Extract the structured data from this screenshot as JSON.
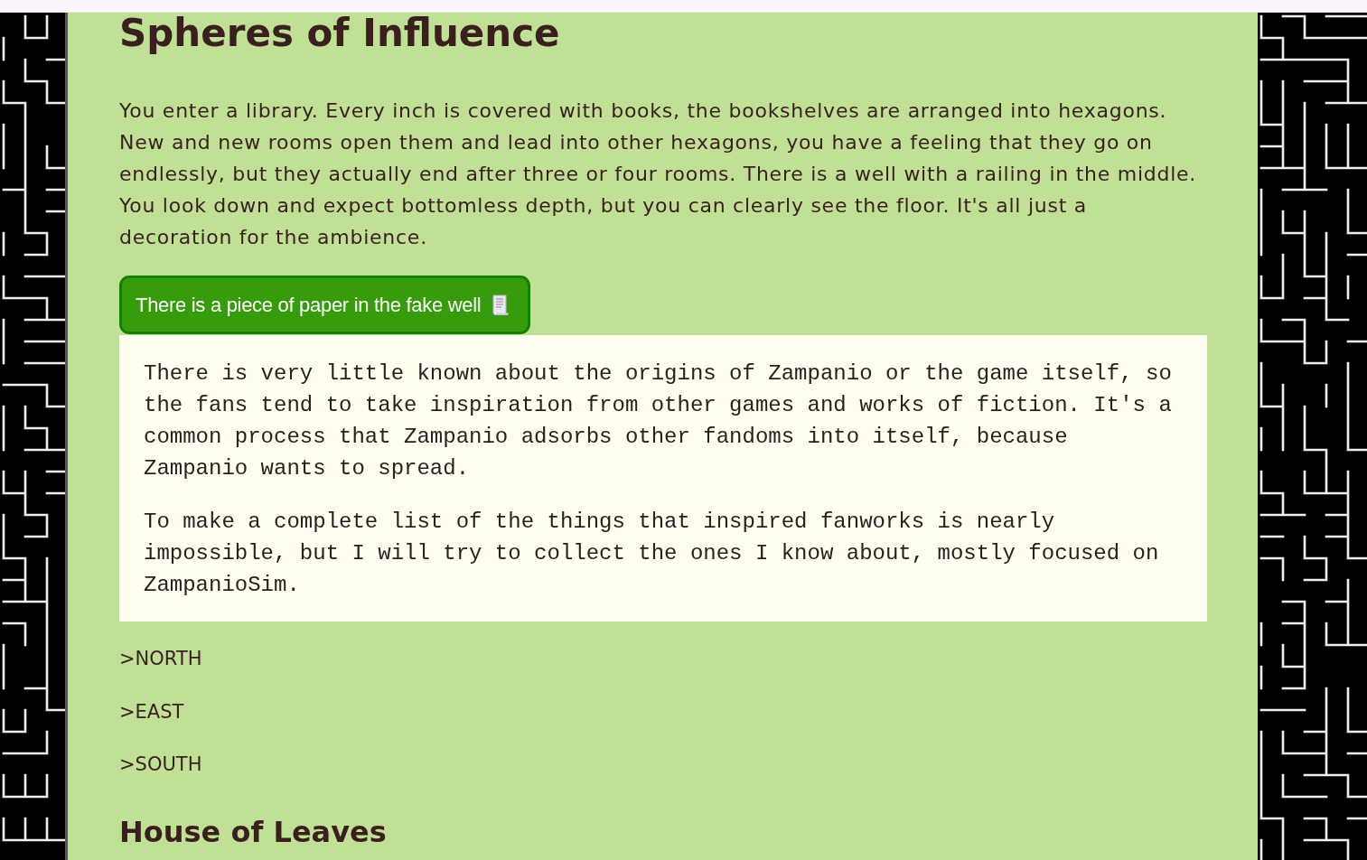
{
  "heading": "Spheres of Influence",
  "description": "You enter a library. Every inch is covered with books, the bookshelves are arranged into hexagons. New and new rooms open them and lead into other hexagons, you have a feeling that they go on endlessly, but they actually end after three or four rooms. There is a well with a railing in the middle. You look down and expect bottomless depth, but you can clearly see the floor. It's all just a decoration for the ambience.",
  "reveal_button": {
    "label": "There is a piece of paper in the fake well"
  },
  "paper_note": {
    "paragraphs": [
      "There is very little known about the origins of Zampanio or the game itself, so the fans tend to take inspiration from other games and works of fiction. It's a common process that Zampanio adsorbs other fandoms into itself, because Zampanio wants to spread.",
      "To make a complete list of the things that inspired fanworks is nearly impossible, but I will try to collect the ones I know about, mostly focused on ZampanioSim."
    ]
  },
  "exits": [
    {
      "label": ">NORTH"
    },
    {
      "label": ">EAST"
    },
    {
      "label": ">SOUTH"
    }
  ],
  "next_heading": "House of Leaves"
}
